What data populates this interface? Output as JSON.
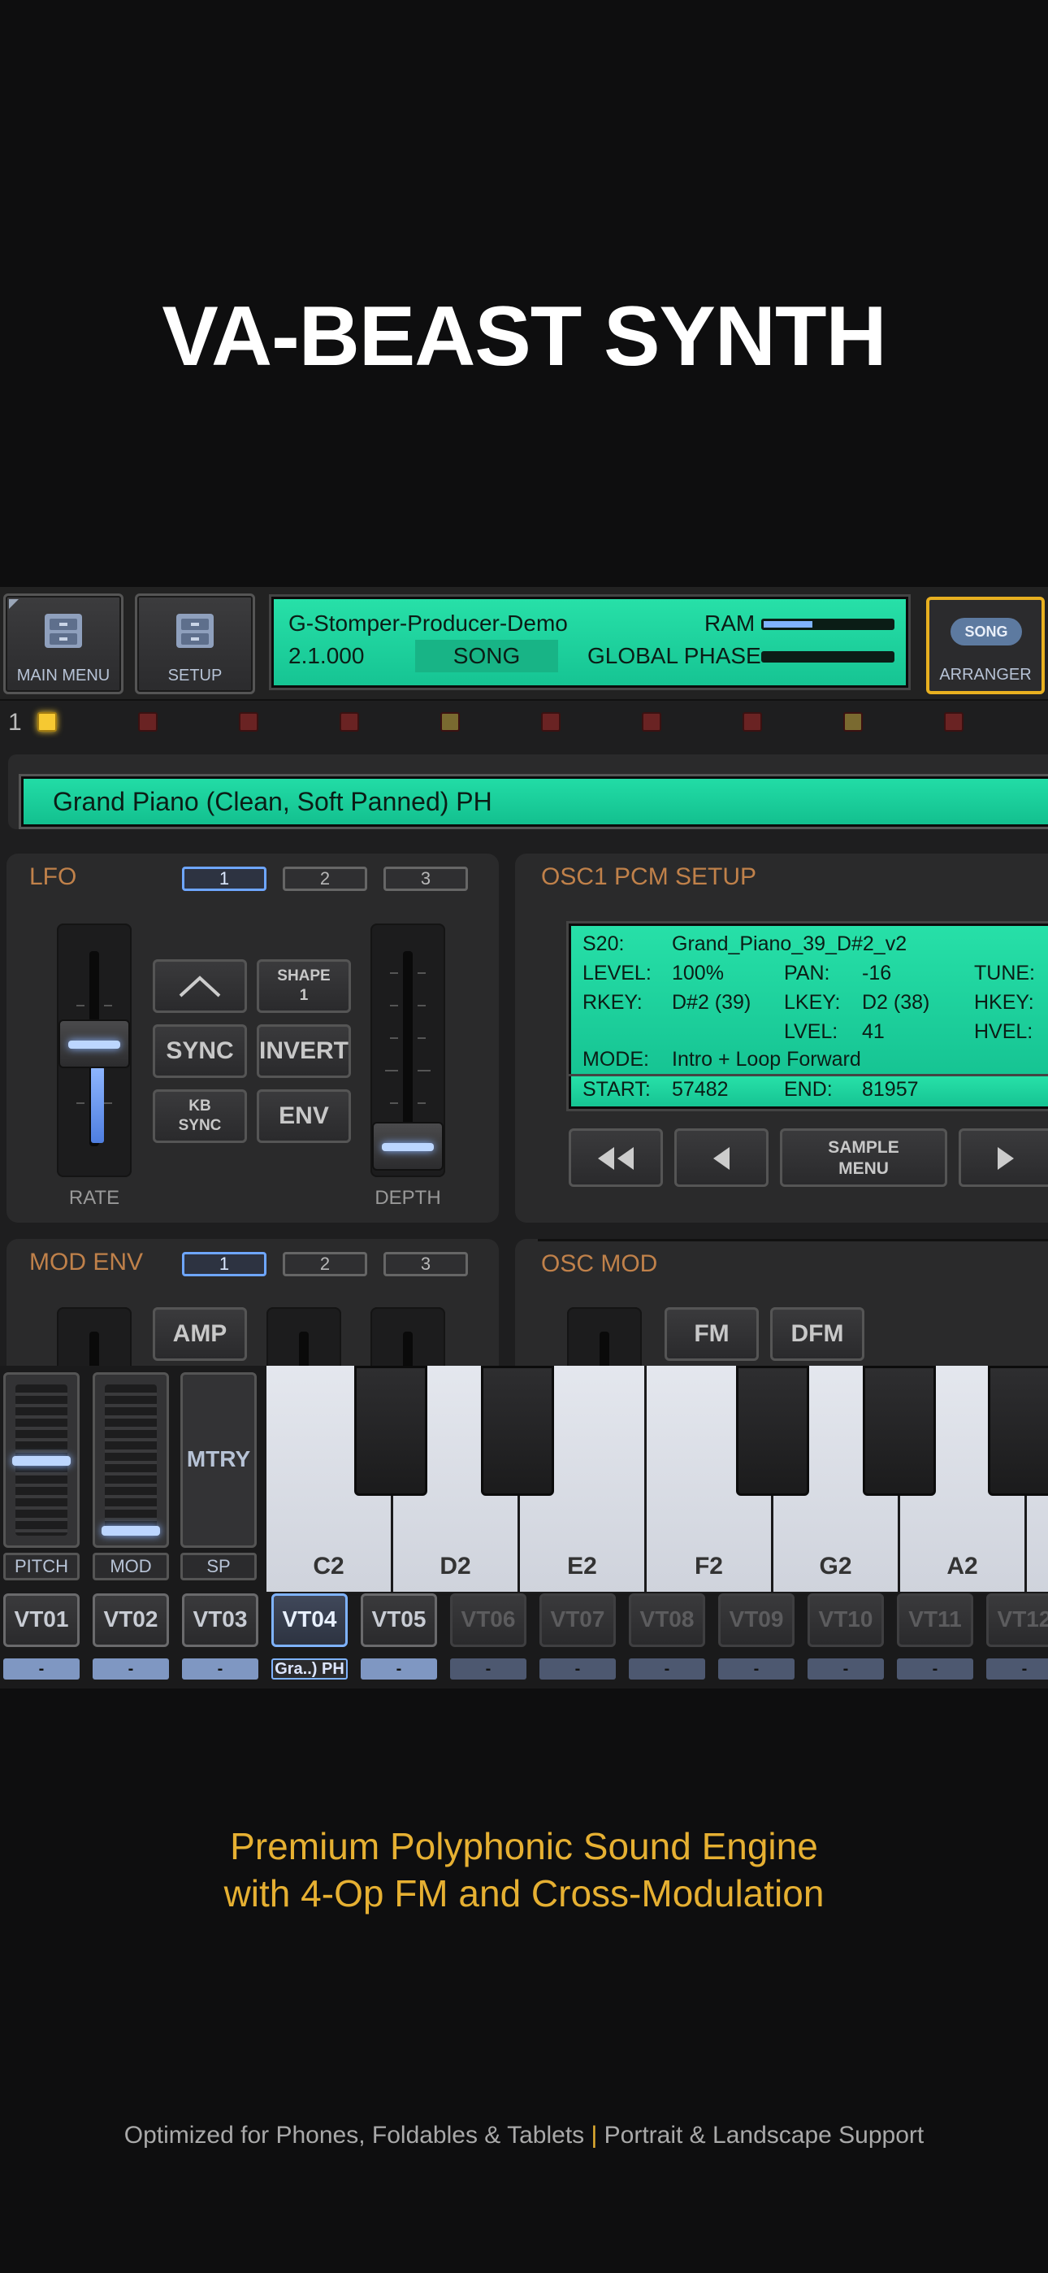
{
  "headline": "VA-BEAST SYNTH",
  "topbar": {
    "main_menu": "MAIN MENU",
    "setup": "SETUP",
    "project": "G-Stomper-Producer-Demo",
    "version": "2.1.000",
    "song": "SONG",
    "ram": "RAM",
    "ram_fraction": 0.38,
    "global_phase": "GLOBAL PHASE",
    "song_pill": "SONG",
    "arranger": "ARRANGER"
  },
  "pattern_index": "1",
  "preset_name": "Grand Piano (Clean, Soft Panned) PH",
  "lfo": {
    "title": "LFO",
    "tabs": [
      "1",
      "2",
      "3"
    ],
    "shape_label": "SHAPE",
    "shape_value": "1",
    "sync": "SYNC",
    "invert": "INVERT",
    "kb_sync_1": "KB",
    "kb_sync_2": "SYNC",
    "env": "ENV",
    "rate": "RATE",
    "depth": "DEPTH"
  },
  "osc": {
    "title": "OSC1 PCM SETUP",
    "sample_id": "S20:",
    "sample_name": "Grand_Piano_39_D#2_v2",
    "level_label": "LEVEL:",
    "level_value": "100%",
    "pan_label": "PAN:",
    "pan_value": "-16",
    "tune_label": "TUNE:",
    "rkey_label": "RKEY:",
    "rkey_value": "D#2 (39)",
    "lkey_label": "LKEY:",
    "lkey_value": "D2 (38)",
    "hkey_label": "HKEY:",
    "lvel_label": "LVEL:",
    "lvel_value": "41",
    "hvel_label": "HVEL:",
    "mode_label": "MODE:",
    "mode_value": "Intro + Loop Forward",
    "start_label": "START:",
    "start_value": "57482",
    "end_label": "END:",
    "end_value": "81957",
    "sample_menu_1": "SAMPLE",
    "sample_menu_2": "MENU"
  },
  "mod_env": {
    "title": "MOD ENV",
    "tabs": [
      "1",
      "2",
      "3"
    ],
    "amp": "AMP"
  },
  "osc_mod": {
    "title": "OSC MOD",
    "fm": "FM",
    "dfm": "DFM"
  },
  "keyboard": {
    "pitch": "PITCH",
    "mod": "MOD",
    "mtry": "MTRY",
    "sp": "SP",
    "keys": [
      "C2",
      "D2",
      "E2",
      "F2",
      "G2",
      "A2"
    ]
  },
  "voice_tracks": [
    {
      "label": "VT01",
      "sub": "-"
    },
    {
      "label": "VT02",
      "sub": "-"
    },
    {
      "label": "VT03",
      "sub": "-"
    },
    {
      "label": "VT04",
      "sub": "Gra..) PH"
    },
    {
      "label": "VT05",
      "sub": "-"
    },
    {
      "label": "VT06",
      "sub": "-"
    },
    {
      "label": "VT07",
      "sub": "-"
    },
    {
      "label": "VT08",
      "sub": "-"
    },
    {
      "label": "VT09",
      "sub": "-"
    },
    {
      "label": "VT10",
      "sub": "-"
    },
    {
      "label": "VT11",
      "sub": "-"
    },
    {
      "label": "VT12",
      "sub": "-"
    }
  ],
  "tagline_1": "Premium Polyphonic Sound Engine",
  "tagline_2": "with 4-Op FM and Cross-Modulation",
  "footer_left": "Optimized for Phones, Foldables & Tablets",
  "footer_sep": "|",
  "footer_right": "Portrait & Landscape Support",
  "colors": {
    "lcd": "#1fd3a0",
    "accent_blue": "#7fb3ff",
    "gold": "#e6b032",
    "section_orange": "#c0814a"
  }
}
